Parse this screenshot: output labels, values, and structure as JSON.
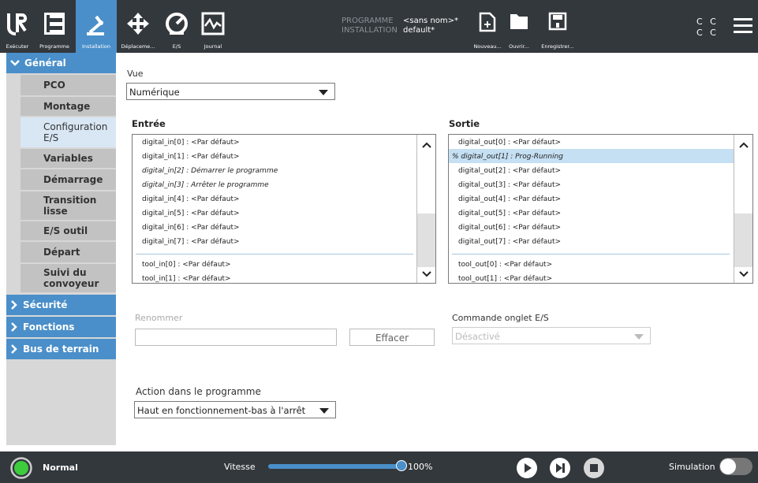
{
  "topbar": {
    "run_label": "Exécuter",
    "program_label": "Programme",
    "install_label": "Installation",
    "move_label": "Déplaceme...",
    "io_label": "E/S",
    "log_label": "Journal",
    "program_key": "PROGRAMME",
    "program_value": "<sans nom>*",
    "installation_key": "INSTALLATION",
    "installation_value": "default*",
    "new_label": "Nouveau...",
    "open_label": "Ouvrir...",
    "save_label": "Enregistrer...",
    "cc_line1": "C C",
    "cc_line2": "C C"
  },
  "sidebar": {
    "general": "Général",
    "items": [
      "PCO",
      "Montage",
      "Configuration E/S",
      "Variables",
      "Démarrage",
      "Transition lisse",
      "E/S outil",
      "Départ",
      "Suivi du convoyeur"
    ],
    "security": "Sécurité",
    "functions": "Fonctions",
    "fieldbus": "Bus de terrain"
  },
  "main": {
    "view_label": "Vue",
    "view_value": "Numérique",
    "input_header": "Entrée",
    "output_header": "Sortie",
    "inputs": [
      "digital_in[0]  :  <Par défaut>",
      "digital_in[1]  :  <Par défaut>",
      "digital_in[2]  :  Démarrer le programme",
      "digital_in[3]  :  Arrêter le programme",
      "digital_in[4]  :  <Par défaut>",
      "digital_in[5]  :  <Par défaut>",
      "digital_in[6]  :  <Par défaut>",
      "digital_in[7]  :  <Par défaut>",
      "tool_in[0]     :  <Par défaut>",
      "tool_in[1]     :  <Par défaut>"
    ],
    "outputs": [
      "digital_out[0] :  <Par défaut>",
      "% digital_out[1] :  Prog-Running",
      "digital_out[2] :  <Par défaut>",
      "digital_out[3] :  <Par défaut>",
      "digital_out[4] :  <Par défaut>",
      "digital_out[5] :  <Par défaut>",
      "digital_out[6] :  <Par défaut>",
      "digital_out[7] :  <Par défaut>",
      "tool_out[0]    :  <Par défaut>",
      "tool_out[1]    :  <Par défaut>"
    ],
    "rename_label": "Renommer",
    "rename_placeholder": "",
    "clear_button": "Effacer",
    "iotab_label": "Commande onglet E/S",
    "iotab_value": "Désactivé",
    "action_label": "Action dans le programme",
    "action_value": "Haut en fonctionnement-bas à l'arrêt"
  },
  "bottombar": {
    "status": "Normal",
    "speed_label": "Vitesse",
    "speed_value": "100%",
    "speed_fraction": 1.0,
    "simulation_label": "Simulation"
  },
  "colors": {
    "accent": "#4a8fc9",
    "bar": "#33383d",
    "status_ok": "#3dcc3d"
  }
}
